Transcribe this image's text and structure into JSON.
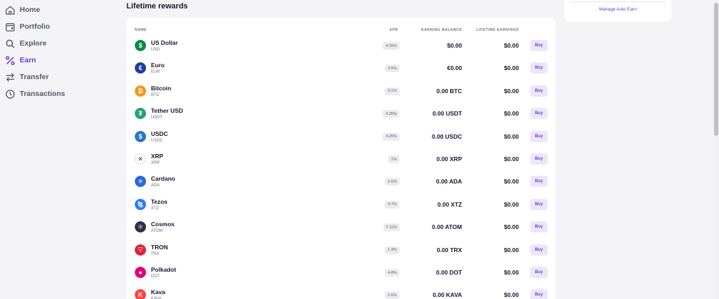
{
  "nav": {
    "items": [
      {
        "label": "Home",
        "icon": "home-icon"
      },
      {
        "label": "Portfolio",
        "icon": "wallet-icon"
      },
      {
        "label": "Explore",
        "icon": "search-icon"
      },
      {
        "label": "Earn",
        "icon": "percent-icon",
        "active": true
      },
      {
        "label": "Transfer",
        "icon": "transfer-arrows-icon"
      },
      {
        "label": "Transactions",
        "icon": "clock-icon"
      }
    ]
  },
  "main": {
    "title": "Lifetime rewards",
    "columns": {
      "name": "NAME",
      "apr": "APR",
      "balance": "EARNING BALANCE",
      "earnings": "LIFETIME EARNINGS"
    },
    "buy_label": "Buy",
    "rows": [
      {
        "name": "US Dollar",
        "symbol": "USD",
        "apr": "4.25%",
        "balance": "$0.00",
        "earnings": "$0.00",
        "icon": "dollar-icon",
        "color": "#0a8a4a",
        "glyph": "$"
      },
      {
        "name": "Euro",
        "symbol": "EUR",
        "apr": "3.5%",
        "balance": "€0.00",
        "earnings": "$0.00",
        "icon": "euro-icon",
        "color": "#1d3f9e",
        "glyph": "€"
      },
      {
        "name": "Bitcoin",
        "symbol": "BTC",
        "apr": "0.1%",
        "balance": "0.00 BTC",
        "earnings": "$0.00",
        "icon": "bitcoin-icon",
        "color": "#f7931a",
        "glyph": "₿"
      },
      {
        "name": "Tether USD",
        "symbol": "USDT",
        "apr": "4.25%",
        "balance": "0.00 USDT",
        "earnings": "$0.00",
        "icon": "tether-icon",
        "color": "#26a17b",
        "glyph": "₮"
      },
      {
        "name": "USDC",
        "symbol": "USDC",
        "apr": "4.25%",
        "balance": "0.00 USDC",
        "earnings": "$0.00",
        "icon": "usdc-icon",
        "color": "#2775ca",
        "glyph": "$"
      },
      {
        "name": "XRP",
        "symbol": "XRP",
        "apr": "1%",
        "balance": "0.00 XRP",
        "earnings": "$0.00",
        "icon": "xrp-icon",
        "color": "#ffffff",
        "glyph": "✕"
      },
      {
        "name": "Cardano",
        "symbol": "ADA",
        "apr": "2-6%",
        "balance": "0.00 ADA",
        "earnings": "$0.00",
        "icon": "cardano-icon",
        "color": "#2a6ad8",
        "glyph": "✳"
      },
      {
        "name": "Tezos",
        "symbol": "XTZ",
        "apr": "4-7%",
        "balance": "0.00 XTZ",
        "earnings": "$0.00",
        "icon": "tezos-icon",
        "color": "#2c7df7",
        "glyph": "ꜩ"
      },
      {
        "name": "Cosmos",
        "symbol": "ATOM",
        "apr": "7-11%",
        "balance": "0.00 ATOM",
        "earnings": "$0.00",
        "icon": "cosmos-icon",
        "color": "#2e3148",
        "glyph": "⚛"
      },
      {
        "name": "TRON",
        "symbol": "TRX",
        "apr": "1-3%",
        "balance": "0.00 TRX",
        "earnings": "$0.00",
        "icon": "tron-icon",
        "color": "#d8253a",
        "glyph": "▽"
      },
      {
        "name": "Polkadot",
        "symbol": "DOT",
        "apr": "4-8%",
        "balance": "0.00 DOT",
        "earnings": "$0.00",
        "icon": "polkadot-icon",
        "color": "#e6007a",
        "glyph": "●"
      },
      {
        "name": "Kava",
        "symbol": "KAVA",
        "apr": "2-5%",
        "balance": "0.00 KAVA",
        "earnings": "$0.00",
        "icon": "kava-icon",
        "color": "#ff433e",
        "glyph": "K"
      }
    ]
  },
  "side": {
    "manage_label": "Manage Auto Earn"
  },
  "colors": {
    "accent": "#6b3fd4",
    "background": "#f4f4f6"
  }
}
